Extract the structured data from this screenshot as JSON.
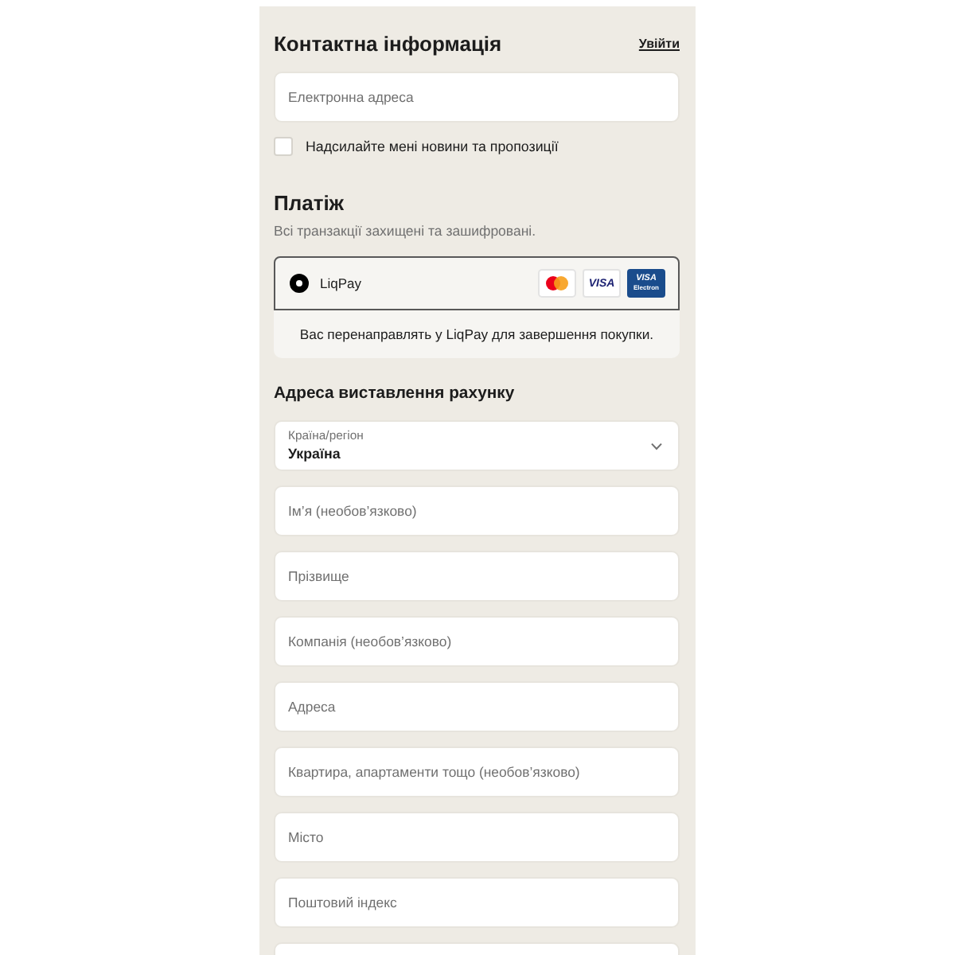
{
  "contact": {
    "title": "Контактна інформація",
    "login_link": "Увійти",
    "email": {
      "placeholder": "Електронна адреса"
    },
    "newsletter": {
      "label": "Надсилайте мені новини та пропозиції",
      "checked": false
    }
  },
  "payment": {
    "title": "Платіж",
    "subtitle": "Всі транзакції захищені та зашифровані.",
    "methods": [
      {
        "label": "LiqPay",
        "selected": true,
        "cards": [
          {
            "kind": "mastercard"
          },
          {
            "kind": "visa",
            "text": "VISA"
          },
          {
            "kind": "visa-electron",
            "text": "VISA",
            "subtext": "Electron"
          }
        ]
      }
    ],
    "redirect_note": "Вас перенаправлять у LiqPay для завершення покупки."
  },
  "billing": {
    "title": "Адреса виставлення рахунку",
    "fields": [
      {
        "kind": "select",
        "label": "Країна/регіон",
        "value": "Україна"
      },
      {
        "kind": "text",
        "placeholder": "Ім’я (необов’язково)"
      },
      {
        "kind": "text",
        "placeholder": "Прізвище"
      },
      {
        "kind": "text",
        "placeholder": "Компанія (необов’язково)"
      },
      {
        "kind": "text",
        "placeholder": "Адреса"
      },
      {
        "kind": "text",
        "placeholder": "Квартира, апартаменти тощо (необов’язково)"
      },
      {
        "kind": "text",
        "placeholder": "Місто"
      },
      {
        "kind": "text",
        "placeholder": "Поштовий індекс"
      },
      {
        "kind": "text"
      }
    ]
  }
}
